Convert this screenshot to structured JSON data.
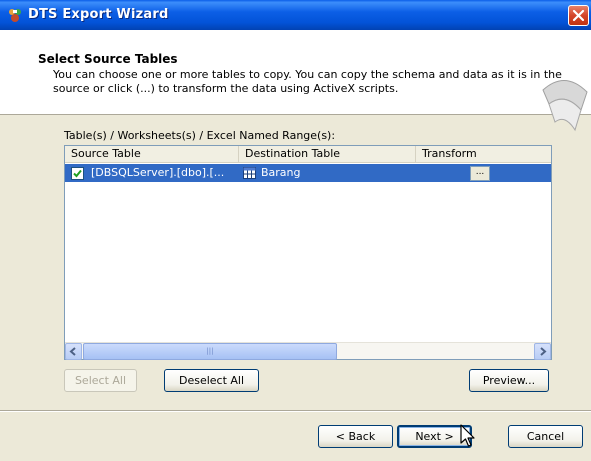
{
  "window": {
    "title": "DTS Export Wizard"
  },
  "header": {
    "title": "Select Source Tables",
    "description_line1": "You can choose one or more tables to copy.  You can copy the schema and data as it is in the",
    "description_line2": "source or click (...) to transform the data using ActiveX scripts."
  },
  "tables_group": {
    "label": "Table(s) / Worksheets(s) / Excel Named Range(s):",
    "columns": [
      "Source Table",
      "Destination Table",
      "Transform"
    ],
    "rows": [
      {
        "checked": true,
        "source": "[DBSQLServer].[dbo].[...",
        "destination": "Barang",
        "transform_button": "..."
      }
    ],
    "scrollbar_thumb_grip": "|||"
  },
  "list_buttons": {
    "select_all": "Select All",
    "deselect_all": "Deselect All",
    "preview": "Preview..."
  },
  "nav_buttons": {
    "back": "< Back",
    "next": "Next >",
    "cancel": "Cancel"
  },
  "colors": {
    "titlebar": "#0353d8",
    "selection": "#316ac5",
    "dialog_bg": "#ece9d8"
  },
  "icons": [
    "app-icon",
    "close-icon",
    "wizard-header-icon",
    "table-icon",
    "checkbox-checked",
    "scroll-left-icon",
    "scroll-right-icon",
    "mouse-cursor-icon"
  ]
}
